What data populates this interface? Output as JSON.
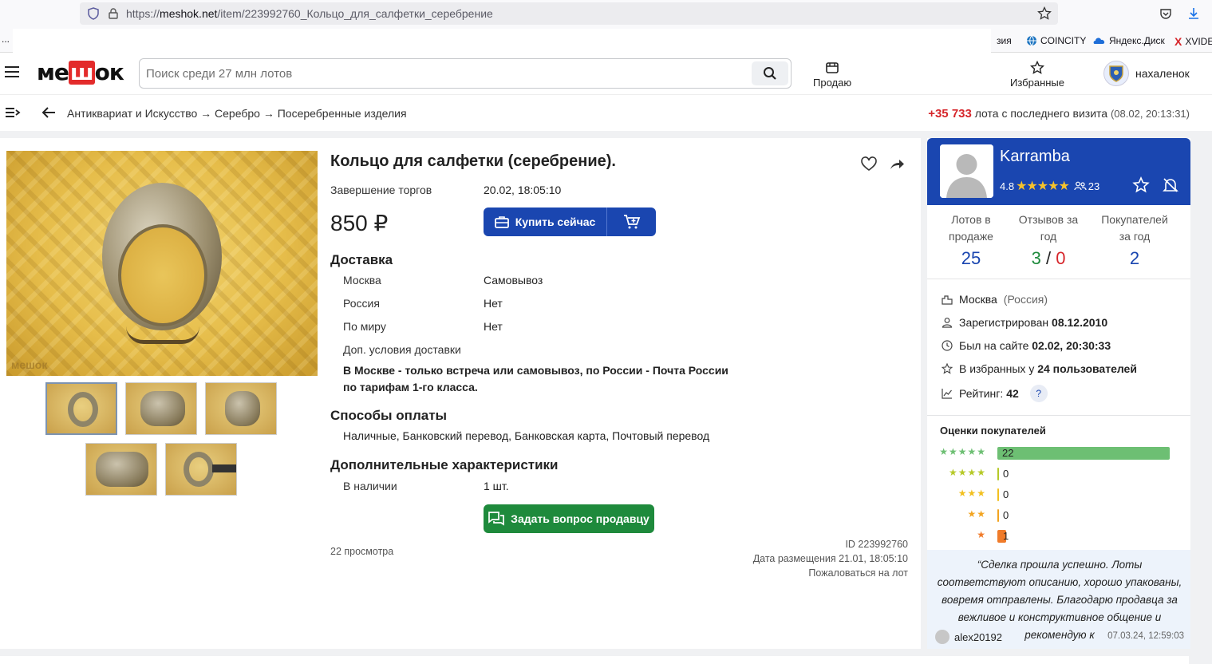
{
  "browser": {
    "url_prefix": "https://",
    "url_host": "meshok.net",
    "url_path": "/item/223992760_Кольцо_для_салфетки_серебрение",
    "bookmarks": [
      {
        "label": "зия"
      },
      {
        "label": "COINCITY"
      },
      {
        "label": "Яндекс.Диск"
      },
      {
        "label": "XVIDE"
      }
    ],
    "overflow_label": "..."
  },
  "header": {
    "logo_left": "ме",
    "logo_mid": "ш",
    "logo_right": "ок",
    "search_placeholder": "Поиск среди 27 млн лотов",
    "sell_label": "Продаю",
    "favorites_label": "Избранные",
    "username": "нахаленок"
  },
  "breadcrumb": {
    "path": "Антиквариат и Искусство → Серебро → Посеребренные изделия",
    "new_count": "+35 733",
    "new_text": "лота с последнего визита",
    "new_date": "(08.02, 20:13:31)"
  },
  "lot": {
    "title": "Кольцо для салфетки (серебрение).",
    "watermark": "мешок",
    "end_label": "Завершение торгов",
    "end_value": "20.02, 18:05:10",
    "price": "850 ₽",
    "buy_label": "Купить сейчас",
    "delivery_title": "Доставка",
    "delivery": [
      {
        "region": "Москва",
        "value": "Самовывоз"
      },
      {
        "region": "Россия",
        "value": "Нет"
      },
      {
        "region": "По миру",
        "value": "Нет"
      }
    ],
    "extra_delivery_label": "Доп. условия доставки",
    "extra_delivery_text": "В Москве - только встреча или самовывоз, по России - Почта России по тарифам 1-го класса.",
    "payment_title": "Способы оплаты",
    "payment_text": "Наличные, Банковский перевод, Банковская карта, Почтовый перевод",
    "extra_title": "Дополнительные характеристики",
    "stock_label": "В наличии",
    "stock_value": "1 шт.",
    "ask_label": "Задать вопрос продавцу",
    "views": "22 просмотра",
    "id_text": "ID 223992760",
    "posted_text": "Дата размещения 21.01, 18:05:10",
    "complain_text": "Пожаловаться на лот"
  },
  "seller": {
    "name": "Karramba",
    "rating": "4.8",
    "followers": "23",
    "stats": [
      {
        "label": "Лотов в продаже",
        "value": "25"
      },
      {
        "label": "Отзывов за год",
        "pos": "3",
        "sep": "/",
        "neg": "0"
      },
      {
        "label": "Покупателей за год",
        "value": "2"
      }
    ],
    "city": "Москва",
    "country": "(Россия)",
    "registered_label": "Зарегистрирован",
    "registered_value": "08.12.2010",
    "last_seen_label": "Был на сайте",
    "last_seen_value": "02.02, 20:30:33",
    "fav_label": "В избранных у",
    "fav_value": "24 пользователей",
    "score_label": "Рейтинг:",
    "score_value": "42",
    "help": "?",
    "ratings_title": "Оценки покупателей",
    "ratings": [
      {
        "stars": "★★★★★",
        "count": "22",
        "fraction": 1.0,
        "color": "#6dbf73",
        "star_color": "#6dbf73"
      },
      {
        "stars": "★★★★",
        "count": "0",
        "fraction": 0,
        "color": "#b6c928",
        "star_color": "#b6c928"
      },
      {
        "stars": "★★★",
        "count": "0",
        "fraction": 0,
        "color": "#f2c020",
        "star_color": "#f2c020"
      },
      {
        "stars": "★★",
        "count": "0",
        "fraction": 0,
        "color": "#f2a420",
        "star_color": "#f2a420"
      },
      {
        "stars": "★",
        "count": "1",
        "fraction": 0.05,
        "color": "#f07b2a",
        "star_color": "#f07b2a"
      }
    ],
    "review_text": "“Сделка прошла успешно. Лоты соответствуют описанию, хорошо упакованы, вовремя отправлены. Благодарю продавца за вежливое и конструктивное общение и рекомендую к",
    "review_author": "alex20192",
    "review_date": "07.03.24, 12:59:03"
  }
}
